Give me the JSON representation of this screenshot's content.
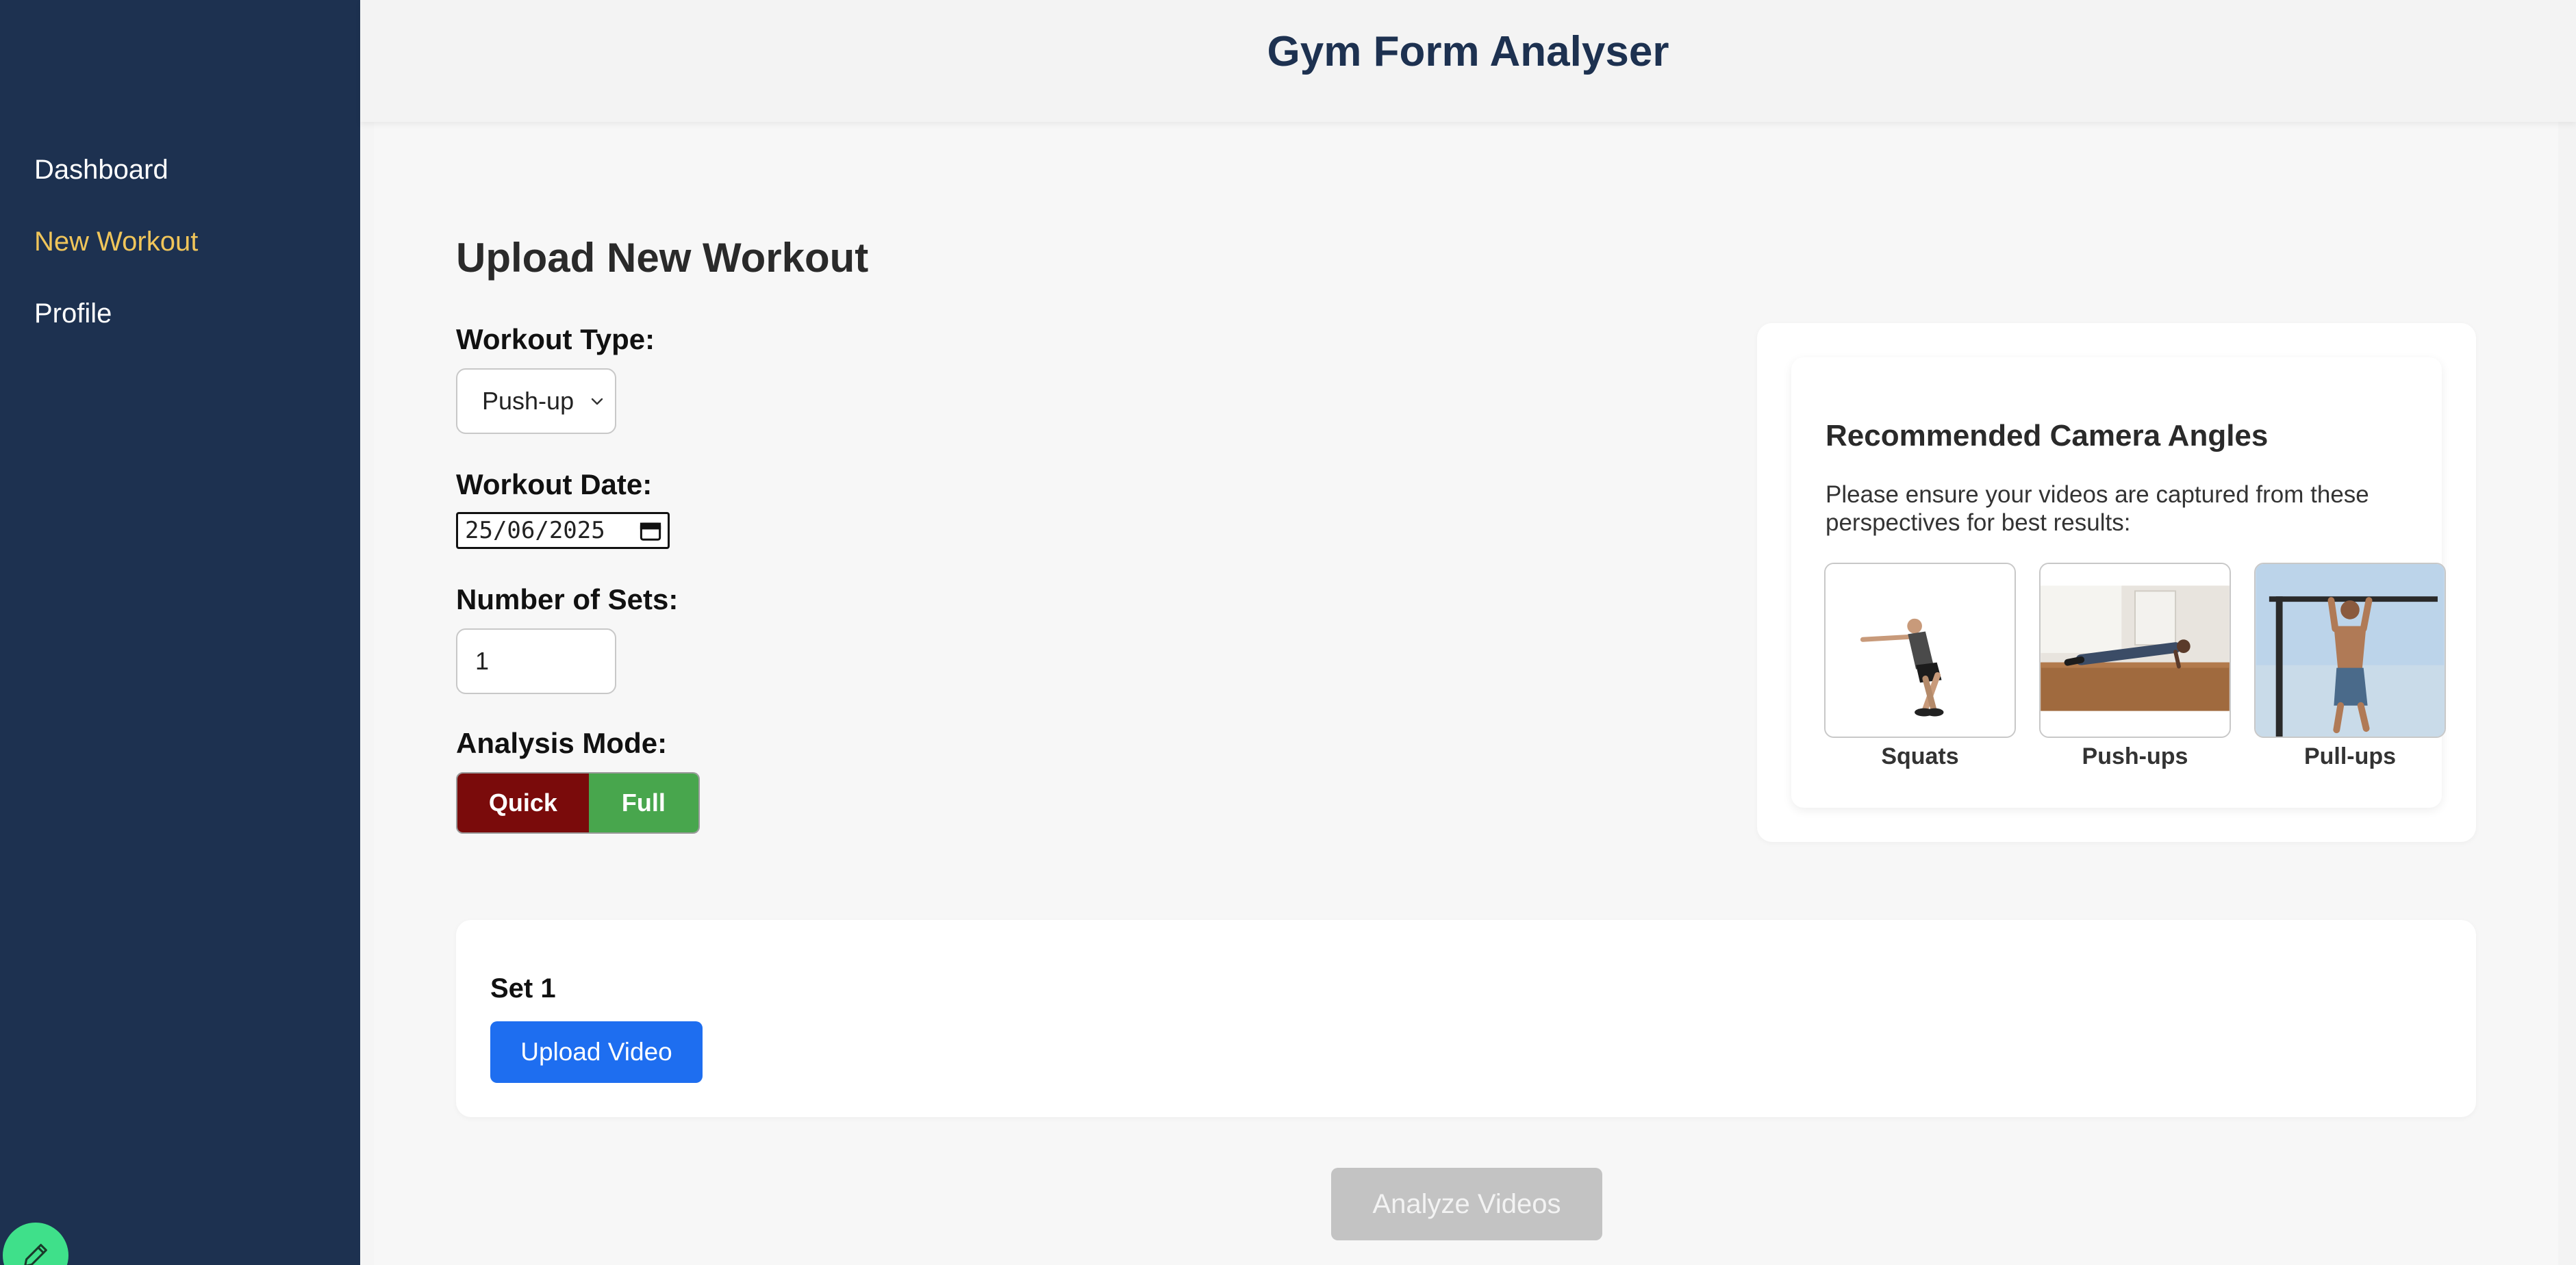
{
  "app": {
    "title": "Gym Form Analyser"
  },
  "sidebar": {
    "items": [
      {
        "label": "Dashboard",
        "active": false
      },
      {
        "label": "New Workout",
        "active": true
      },
      {
        "label": "Profile",
        "active": false
      }
    ],
    "fab_icon": "pencil-icon"
  },
  "form": {
    "page_title": "Upload New Workout",
    "workout_type": {
      "label": "Workout Type:",
      "value": "Push-up"
    },
    "workout_date": {
      "label": "Workout Date:",
      "value": "25/06/2025"
    },
    "num_sets": {
      "label": "Number of Sets:",
      "value": "1"
    },
    "analysis_mode": {
      "label": "Analysis Mode:",
      "options": [
        "Quick",
        "Full"
      ],
      "selected": "Quick"
    }
  },
  "camera": {
    "title": "Recommended Camera Angles",
    "description": "Please ensure your videos are captured from these perspectives for best results:",
    "items": [
      {
        "caption": "Squats"
      },
      {
        "caption": "Push-ups"
      },
      {
        "caption": "Pull-ups"
      }
    ]
  },
  "sets": [
    {
      "title": "Set 1",
      "upload_label": "Upload Video"
    }
  ],
  "analyze_label": "Analyze Videos",
  "colors": {
    "sidebar_bg": "#1d3150",
    "nav_active": "#f0c55a",
    "quick_btn": "#7a0b0b",
    "full_btn": "#48a64d",
    "upload_btn": "#1e6ef0",
    "analyze_disabled": "#c3c3c3",
    "fab": "#3fe08a"
  }
}
